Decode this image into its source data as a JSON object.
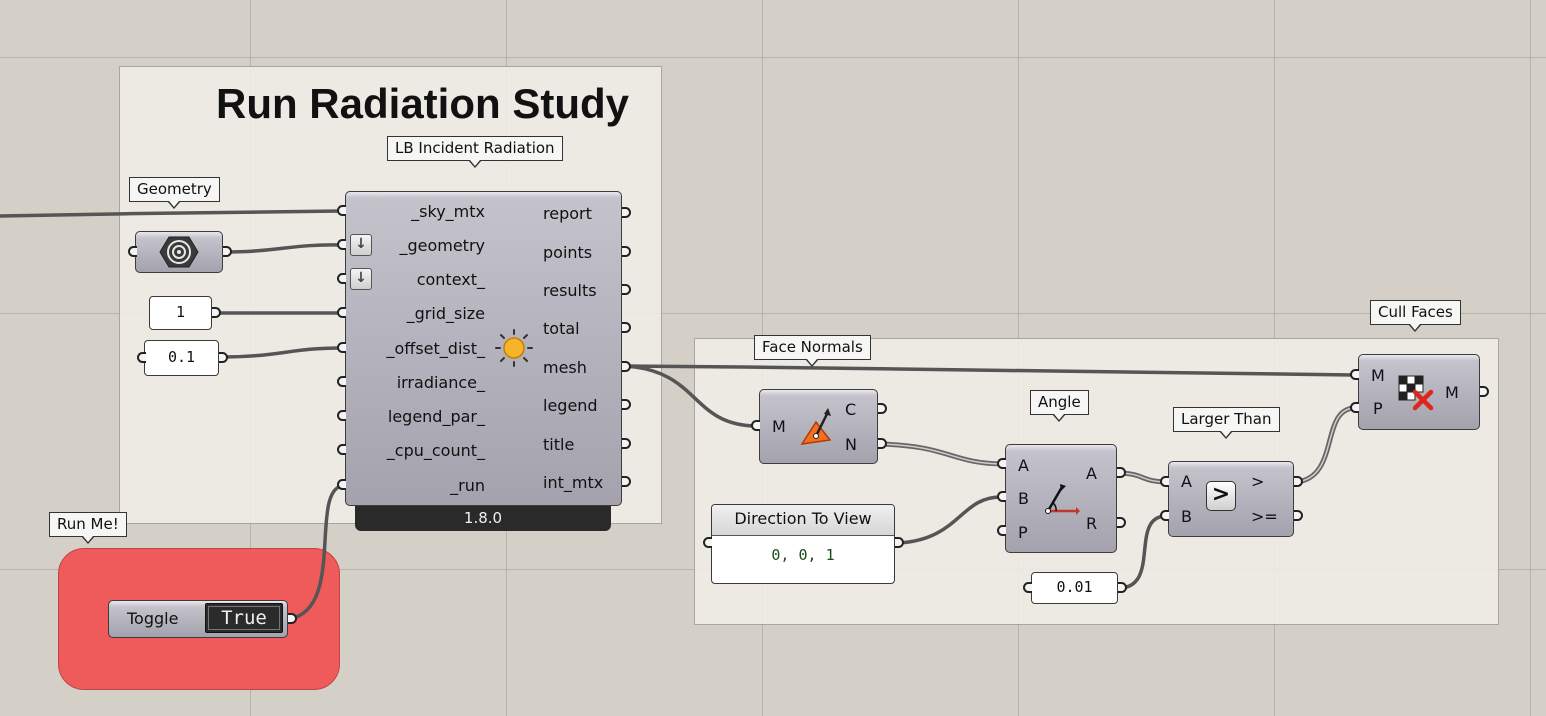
{
  "group_title": "Run Radiation Study",
  "tags": {
    "geometry": "Geometry",
    "lb_incident": "LB Incident Radiation",
    "run_me": "Run Me!",
    "face_normals": "Face Normals",
    "angle": "Angle",
    "larger_than": "Larger Than",
    "cull_faces": "Cull Faces"
  },
  "lb_component": {
    "inputs": [
      "_sky_mtx",
      "_geometry",
      "context_",
      "_grid_size",
      "_offset_dist_",
      "irradiance_",
      "legend_par_",
      "_cpu_count_",
      "_run"
    ],
    "outputs": [
      "report",
      "points",
      "results",
      "total",
      "mesh",
      "legend",
      "title",
      "int_mtx"
    ],
    "version": "1.8.0",
    "icon": "sun-icon"
  },
  "panels": {
    "grid_size_value": "1",
    "offset_value": "0.1",
    "direction_title": "Direction To View",
    "direction_value": "0, 0, 1",
    "threshold_value": "0.01"
  },
  "toggle": {
    "label": "Toggle",
    "value": "True"
  },
  "face_normals": {
    "inputs": [
      "M"
    ],
    "outputs": [
      "C",
      "N"
    ],
    "icon": "face-normals-icon"
  },
  "angle": {
    "inputs": [
      "A",
      "B",
      "P"
    ],
    "outputs": [
      "A",
      "R"
    ],
    "icon": "angle-icon"
  },
  "larger_than": {
    "inputs": [
      "A",
      "B"
    ],
    "outputs": [
      ">",
      ">="
    ],
    "icon_label": ">"
  },
  "cull_faces": {
    "inputs": [
      "M",
      "P"
    ],
    "outputs": [
      "M"
    ],
    "icon": "cull-faces-icon"
  },
  "colors": {
    "canvas": "#d4d0c8",
    "red_group": "#ef5a5a",
    "component": "#a3a2ad",
    "wire": "#555555"
  }
}
